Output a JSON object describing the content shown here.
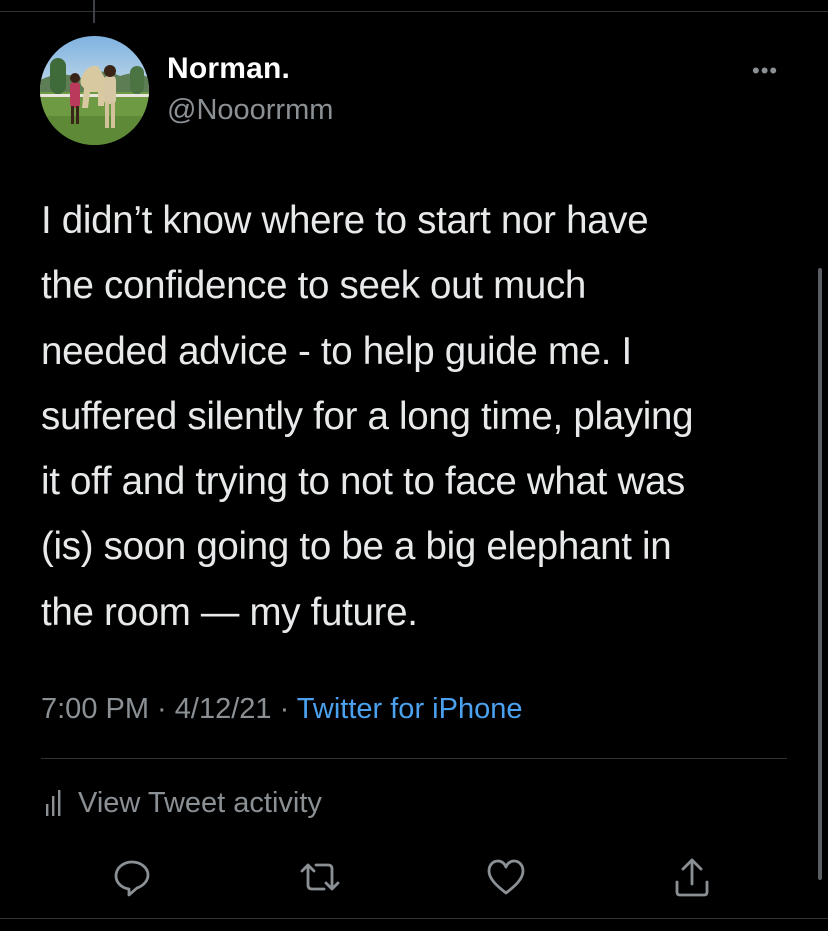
{
  "tweet": {
    "author": {
      "display_name": "Norman.",
      "handle": "@Nooorrmm",
      "avatar_icon": "profile-photo"
    },
    "more_label": "•••",
    "text_lines": [
      "I didn’t know where to start nor have",
      "the confidence to seek out much",
      "needed advice - to help guide me. I",
      "suffered silently for a long time, playing",
      "it off and trying to not to face what was",
      "(is) soon going to be a big elephant in",
      "the room — my future."
    ],
    "time": "7:00 PM",
    "date": "4/12/21",
    "separator": " · ",
    "source": "Twitter for iPhone",
    "activity_label": "View Tweet activity"
  },
  "actions": [
    {
      "icon": "reply-icon"
    },
    {
      "icon": "retweet-icon"
    },
    {
      "icon": "like-icon"
    },
    {
      "icon": "share-icon"
    }
  ],
  "colors": {
    "background": "#000000",
    "text": "#e7e9ea",
    "muted": "#8b9095",
    "link": "#4ca1ef",
    "divider": "#2f3336"
  }
}
